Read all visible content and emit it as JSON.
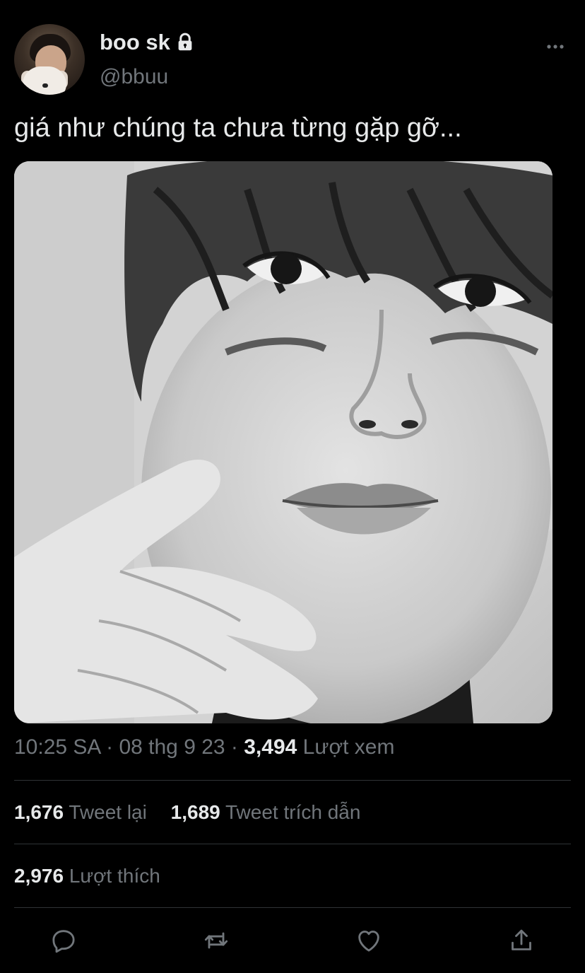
{
  "user": {
    "display_name": "boo sk",
    "handle": "@bbuu",
    "protected_icon": "lock-icon"
  },
  "tweet": {
    "text": "giá như chúng ta chưa từng gặp gỡ..."
  },
  "meta": {
    "time": "10:25 SA",
    "separator1": " · ",
    "date": "08 thg 9 23",
    "separator2": " · ",
    "views_count": "3,494",
    "views_label": " Lượt xem"
  },
  "stats": {
    "retweets_count": "1,676",
    "retweets_label": " Tweet lại",
    "quotes_count": "1,689",
    "quotes_label": " Tweet trích dẫn",
    "likes_count": "2,976",
    "likes_label": " Lượt thích"
  },
  "actions": {
    "reply_icon": "reply-icon",
    "retweet_icon": "retweet-icon",
    "like_icon": "heart-icon",
    "share_icon": "share-icon"
  },
  "colors": {
    "background": "#000000",
    "primary_text": "#e7e9ea",
    "secondary_text": "#71767b",
    "divider": "#2f3336"
  }
}
